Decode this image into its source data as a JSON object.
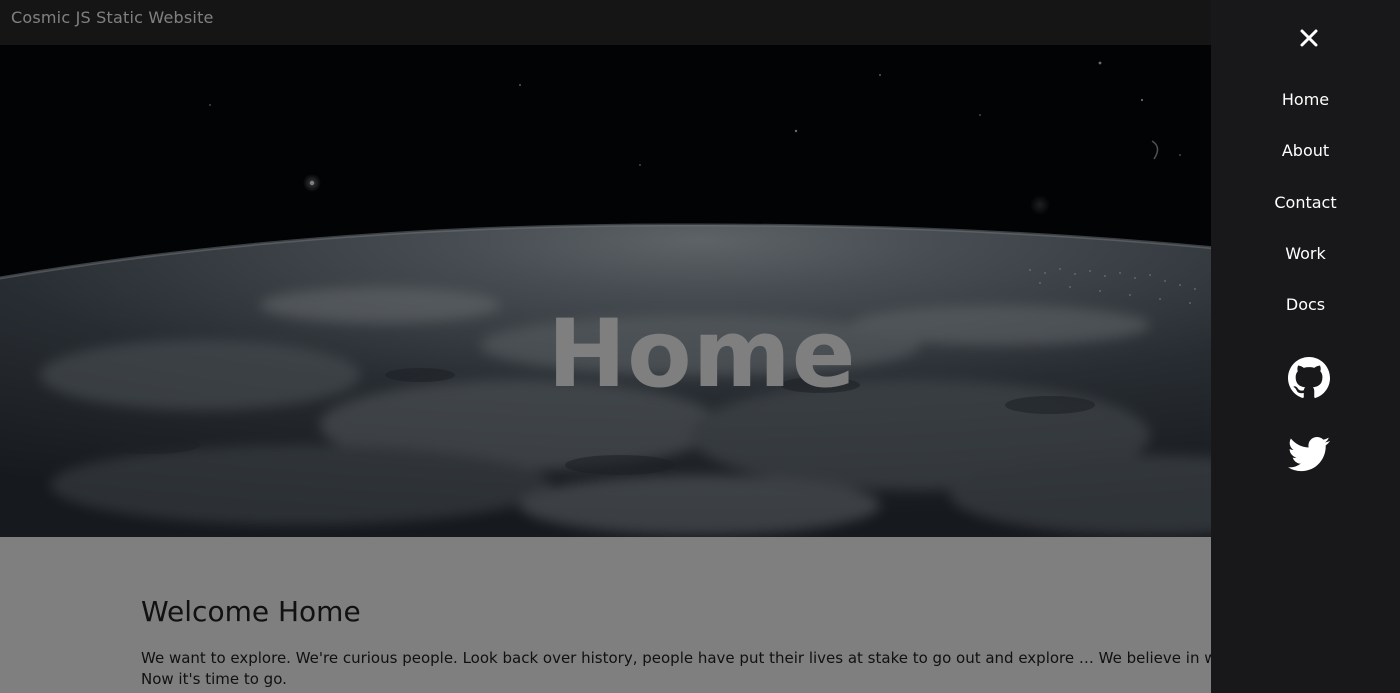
{
  "site": {
    "title": "Cosmic JS Static Website"
  },
  "hero": {
    "title": "Home"
  },
  "content": {
    "heading": "Welcome Home",
    "body": "We want to explore. We're curious people. Look back over history, people have put their lives at stake to go out and explore … We believe in what we're doing. Now it's time to go."
  },
  "drawer": {
    "close_icon": "close-icon",
    "nav_items": [
      {
        "label": "Home"
      },
      {
        "label": "About"
      },
      {
        "label": "Contact"
      },
      {
        "label": "Work"
      },
      {
        "label": "Docs"
      }
    ],
    "social_icons": [
      "github-icon",
      "twitter-icon"
    ]
  },
  "colors": {
    "drawer_background": "#18181a",
    "topbar_background": "#2a2a2c",
    "text_light": "#ffffff",
    "text_dark": "#222222"
  }
}
